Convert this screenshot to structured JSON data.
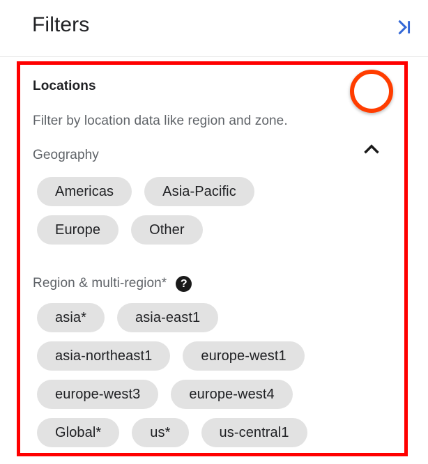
{
  "header": {
    "title": "Filters",
    "collapse_icon": "chevron-right-to-bar-icon",
    "collapse_icon_color": "#3367d6"
  },
  "section": {
    "title": "Locations",
    "description": "Filter by location data like region and zone.",
    "toggle_icon": "chevron-up-icon",
    "expanded": true,
    "groups": [
      {
        "id": "geography",
        "label": "Geography",
        "help_icon": null,
        "rows": [
          [
            "Americas",
            "Asia-Pacific"
          ],
          [
            "Europe",
            "Other"
          ]
        ]
      },
      {
        "id": "region",
        "label": "Region & multi-region*",
        "help_icon": "help-icon",
        "help_glyph": "?",
        "rows": [
          [
            "asia*",
            "asia-east1"
          ],
          [
            "asia-northeast1",
            "europe-west1"
          ],
          [
            "europe-west3",
            "europe-west4"
          ],
          [
            "Global*",
            "us*",
            "us-central1"
          ]
        ]
      }
    ]
  },
  "annotations": {
    "box_color": "#ff0000",
    "circle_color": "#ff3d00",
    "box_target": "locations-section",
    "circle_target": "locations-expand-toggle"
  }
}
